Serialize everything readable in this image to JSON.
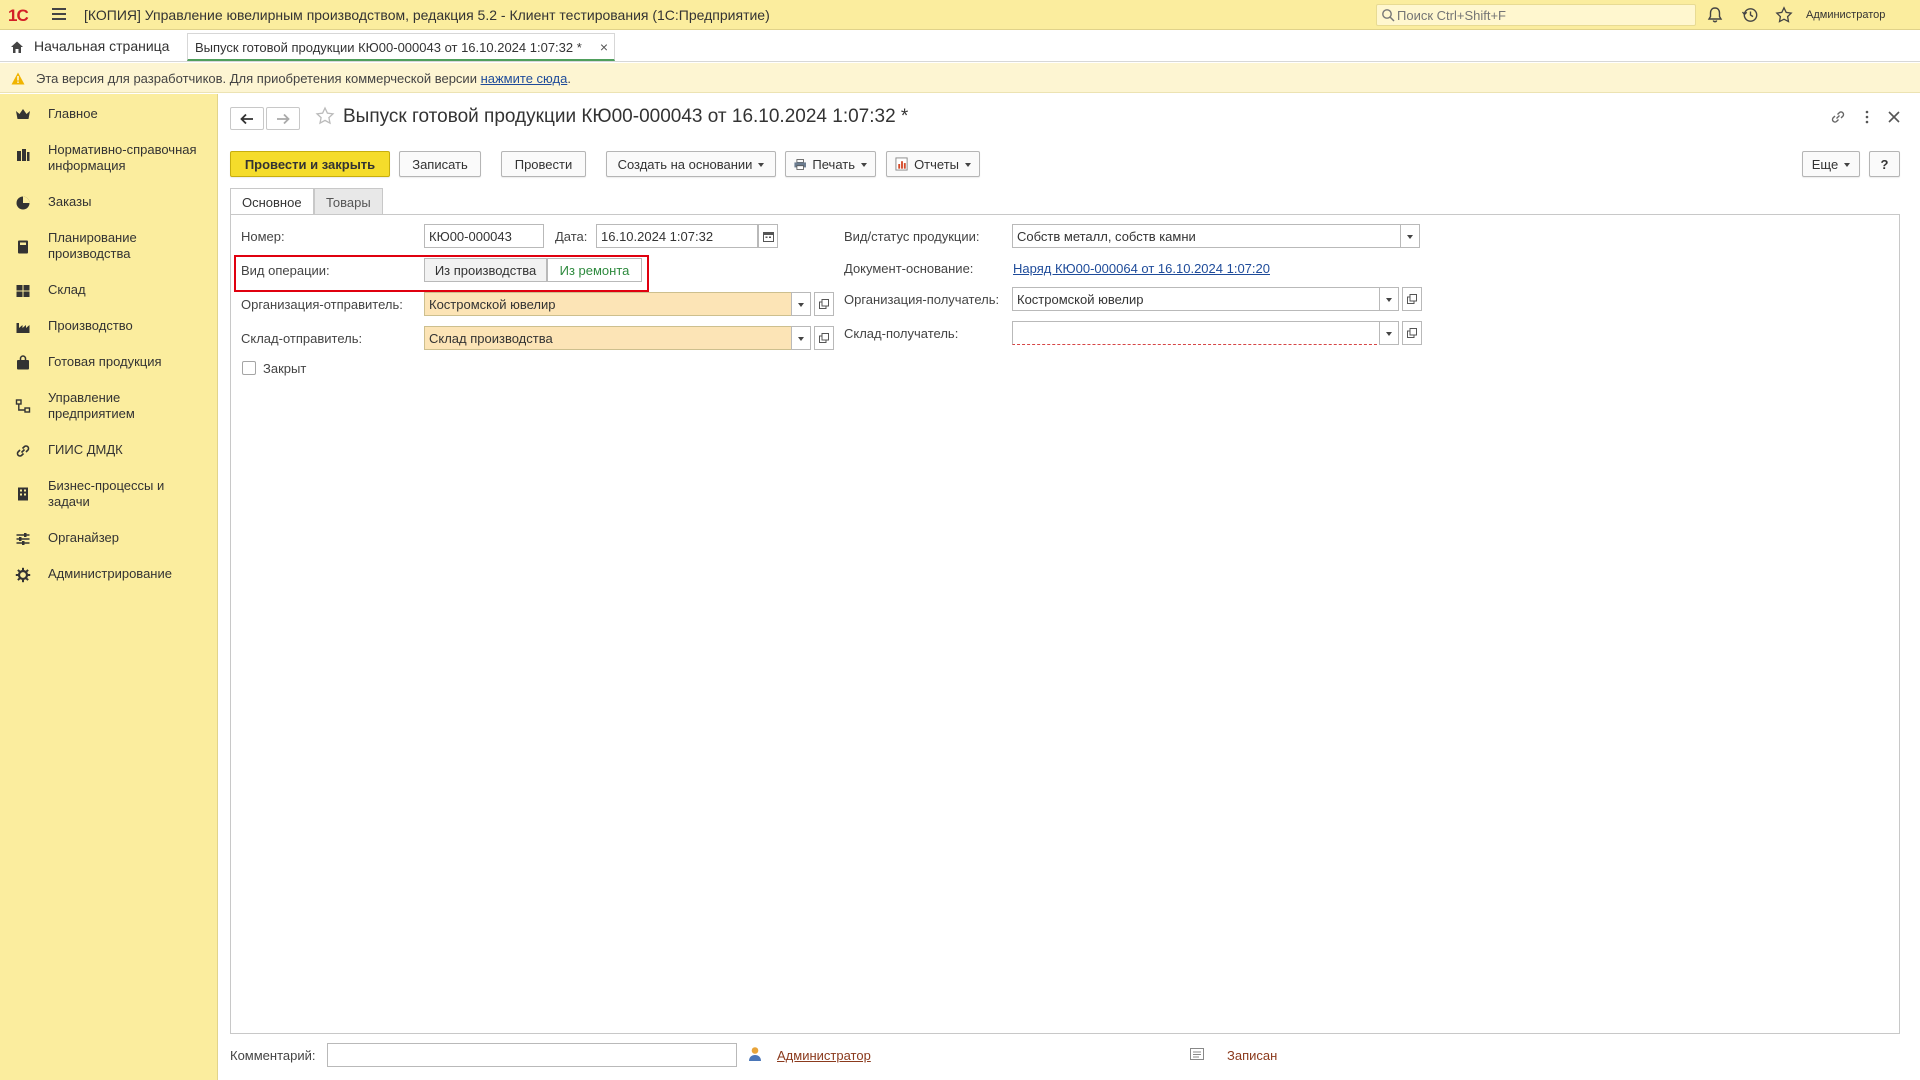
{
  "app": {
    "logo": "1С",
    "title": "[КОПИЯ] Управление ювелирным производством, редакция 5.2  - Клиент тестирования (1С:Предприятие)",
    "search_placeholder": "Поиск Ctrl+Shift+F",
    "user": "Администратор"
  },
  "tabs": {
    "home": "Начальная страница",
    "document": "Выпуск готовой продукции КЮ00-000043 от 16.10.2024 1:07:32 *"
  },
  "warning": {
    "text": "Эта версия для разработчиков. Для приобретения коммерческой версии ",
    "link": "нажмите сюда",
    "tail": "."
  },
  "sidebar": {
    "items": [
      {
        "label": "Главное",
        "icon": "crown-icon"
      },
      {
        "label": "Нормативно-справочная информация",
        "icon": "books-icon"
      },
      {
        "label": "Заказы",
        "icon": "pie-icon"
      },
      {
        "label": "Планирование производства",
        "icon": "calculator-icon"
      },
      {
        "label": "Склад",
        "icon": "grid-icon"
      },
      {
        "label": "Производство",
        "icon": "factory-icon"
      },
      {
        "label": "Готовая продукция",
        "icon": "bag-icon"
      },
      {
        "label": "Управление предприятием",
        "icon": "org-icon"
      },
      {
        "label": "ГИИС ДМДК",
        "icon": "link-icon"
      },
      {
        "label": "Бизнес-процессы и задачи",
        "icon": "building-icon"
      },
      {
        "label": "Органайзер",
        "icon": "sliders-icon"
      },
      {
        "label": "Администрирование",
        "icon": "gear-icon"
      }
    ]
  },
  "document": {
    "title": "Выпуск готовой продукции КЮ00-000043 от 16.10.2024 1:07:32 *"
  },
  "toolbar": {
    "post_close": "Провести и закрыть",
    "save": "Записать",
    "post": "Провести",
    "create_based": "Создать на основании",
    "print": "Печать",
    "reports": "Отчеты",
    "more": "Еще",
    "help": "?"
  },
  "form_tabs": {
    "main": "Основное",
    "goods": "Товары"
  },
  "form": {
    "number_label": "Номер:",
    "number_value": "КЮ00-000043",
    "date_label": "Дата:",
    "date_value": "16.10.2024  1:07:32",
    "op_label": "Вид операции:",
    "op_option1": "Из производства",
    "op_option2": "Из ремонта",
    "op_selected": "Из производства",
    "org_sender_label": "Организация-отправитель:",
    "org_sender_value": "Костромской ювелир",
    "warehouse_sender_label": "Склад-отправитель:",
    "warehouse_sender_value": "Склад производства",
    "closed_label": "Закрыт",
    "closed_checked": false,
    "product_status_label": "Вид/статус продукции:",
    "product_status_value": "Собств металл, собств камни",
    "base_doc_label": "Документ-основание:",
    "base_doc_value": "Наряд КЮ00-000064 от 16.10.2024 1:07:20",
    "org_receiver_label": "Организация-получатель:",
    "org_receiver_value": "Костромской ювелир",
    "warehouse_receiver_label": "Склад-получатель:",
    "warehouse_receiver_value": ""
  },
  "footer": {
    "comment_label": "Комментарий:",
    "comment_value": "",
    "author": "Администратор",
    "status": "Записан"
  },
  "colors": {
    "topbar": "#fbed9e",
    "sidebar": "#fbed9e",
    "primary_button": "#f5dc2b",
    "required_field": "#fce4b6",
    "highlight_box": "#e0000f",
    "link": "#1e4b9a"
  }
}
